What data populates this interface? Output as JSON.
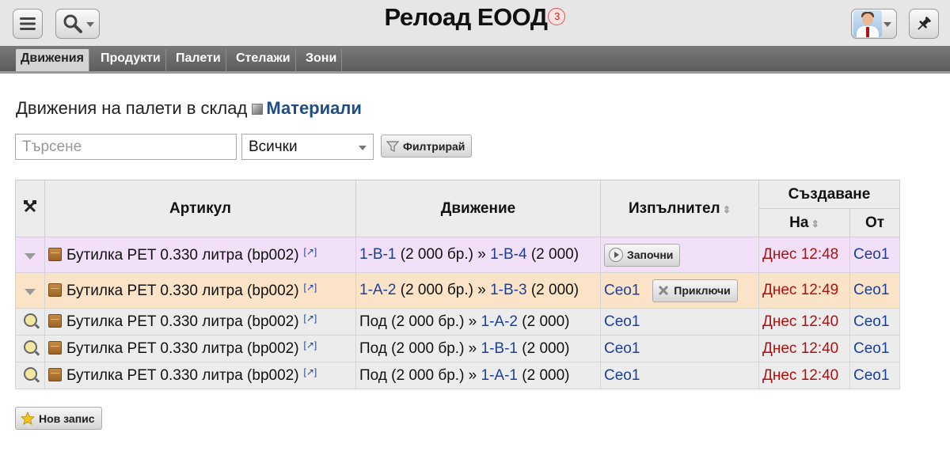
{
  "header": {
    "title": "Релоад ЕООД",
    "notification_count": "3",
    "icons": {
      "menu": "hamburger-menu-icon",
      "search": "search-icon",
      "avatar": "user-avatar",
      "pin": "pushpin-icon"
    }
  },
  "tabs": [
    {
      "label": "Движения",
      "active": true
    },
    {
      "label": "Продукти",
      "active": false
    },
    {
      "label": "Палети",
      "active": false
    },
    {
      "label": "Стелажи",
      "active": false
    },
    {
      "label": "Зони",
      "active": false
    }
  ],
  "page": {
    "title_prefix": "Движения на палети в склад",
    "title_link": "Материали"
  },
  "filter": {
    "search_placeholder": "Търсене",
    "select_value": "Всички",
    "filter_button": "Филтрирай"
  },
  "table": {
    "headers": {
      "article": "Артикул",
      "movement": "Движение",
      "performer": "Изпълнител",
      "created": "Създаване",
      "created_on": "На",
      "created_by": "От"
    },
    "rows": [
      {
        "status": "purple",
        "article": "Бутилка PET 0.330 литра (bp002)",
        "mv_from": "1-B-1",
        "mv_from_qty": " (2 000 бр.) » ",
        "mv_to": "1-B-4",
        "mv_to_qty": " (2 000)",
        "performer": "",
        "action": "Започни",
        "created_on": "Днес 12:48",
        "created_by": "Ceo1"
      },
      {
        "status": "orange",
        "article": "Бутилка PET 0.330 литра (bp002)",
        "mv_from": "1-A-2",
        "mv_from_qty": " (2 000 бр.) » ",
        "mv_to": "1-B-3",
        "mv_to_qty": " (2 000)",
        "performer": "Ceo1",
        "action": "Приключи",
        "created_on": "Днес 12:49",
        "created_by": "Ceo1"
      },
      {
        "status": "plain",
        "article": "Бутилка PET 0.330 литра (bp002)",
        "mv_from": "Под",
        "mv_from_qty": " (2 000 бр.) » ",
        "mv_to": "1-A-2",
        "mv_to_qty": " (2 000)",
        "performer": "Ceo1",
        "action": "",
        "created_on": "Днес 12:40",
        "created_by": "Ceo1"
      },
      {
        "status": "plain",
        "article": "Бутилка PET 0.330 литра (bp002)",
        "mv_from": "Под",
        "mv_from_qty": " (2 000 бр.) » ",
        "mv_to": "1-B-1",
        "mv_to_qty": " (2 000)",
        "performer": "Ceo1",
        "action": "",
        "created_on": "Днес 12:40",
        "created_by": "Ceo1"
      },
      {
        "status": "plain",
        "article": "Бутилка PET 0.330 литра (bp002)",
        "mv_from": "Под",
        "mv_from_qty": " (2 000 бр.) » ",
        "mv_to": "1-A-1",
        "mv_to_qty": " (2 000)",
        "performer": "Ceo1",
        "action": "",
        "created_on": "Днес 12:40",
        "created_by": "Ceo1"
      }
    ]
  },
  "footer": {
    "new_record_button": "Нов запис"
  },
  "colors": {
    "row_active": "#f2dff8",
    "row_in_progress": "#fbe3c7",
    "row_done": "#ececec",
    "link": "#1b3f9e",
    "created_text": "#b01010"
  }
}
